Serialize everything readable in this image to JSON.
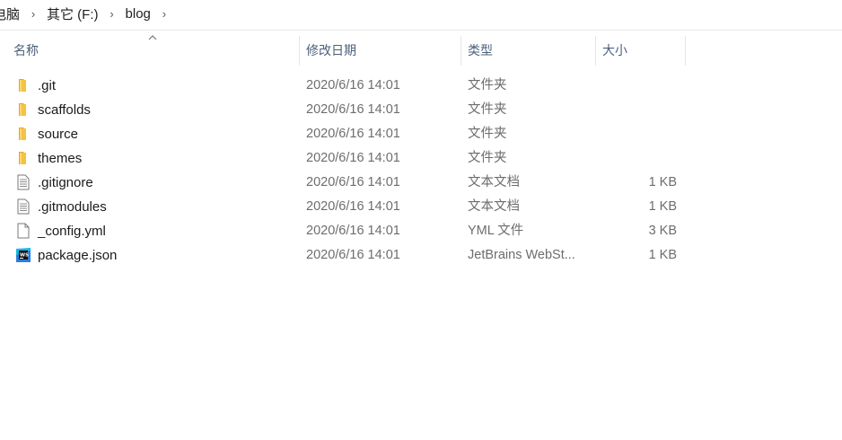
{
  "breadcrumb": {
    "items": [
      "电脑",
      "其它 (F:)",
      "blog"
    ]
  },
  "columns": {
    "name": "名称",
    "date": "修改日期",
    "type": "类型",
    "size": "大小"
  },
  "files": [
    {
      "name": ".git",
      "date": "2020/6/16 14:01",
      "type": "文件夹",
      "size": "",
      "icon": "folder-icon"
    },
    {
      "name": "scaffolds",
      "date": "2020/6/16 14:01",
      "type": "文件夹",
      "size": "",
      "icon": "folder-icon"
    },
    {
      "name": "source",
      "date": "2020/6/16 14:01",
      "type": "文件夹",
      "size": "",
      "icon": "folder-icon"
    },
    {
      "name": "themes",
      "date": "2020/6/16 14:01",
      "type": "文件夹",
      "size": "",
      "icon": "folder-icon"
    },
    {
      "name": ".gitignore",
      "date": "2020/6/16 14:01",
      "type": "文本文档",
      "size": "1 KB",
      "icon": "text-document-icon"
    },
    {
      "name": ".gitmodules",
      "date": "2020/6/16 14:01",
      "type": "文本文档",
      "size": "1 KB",
      "icon": "text-document-icon"
    },
    {
      "name": "_config.yml",
      "date": "2020/6/16 14:01",
      "type": "YML 文件",
      "size": "3 KB",
      "icon": "blank-file-icon"
    },
    {
      "name": "package.json",
      "date": "2020/6/16 14:01",
      "type": "JetBrains WebSt...",
      "size": "1 KB",
      "icon": "webstorm-file-icon"
    }
  ],
  "colors": {
    "folder": "#f5c242",
    "header_text": "#4c607a",
    "webstorm_bg": "#1e88c8"
  }
}
